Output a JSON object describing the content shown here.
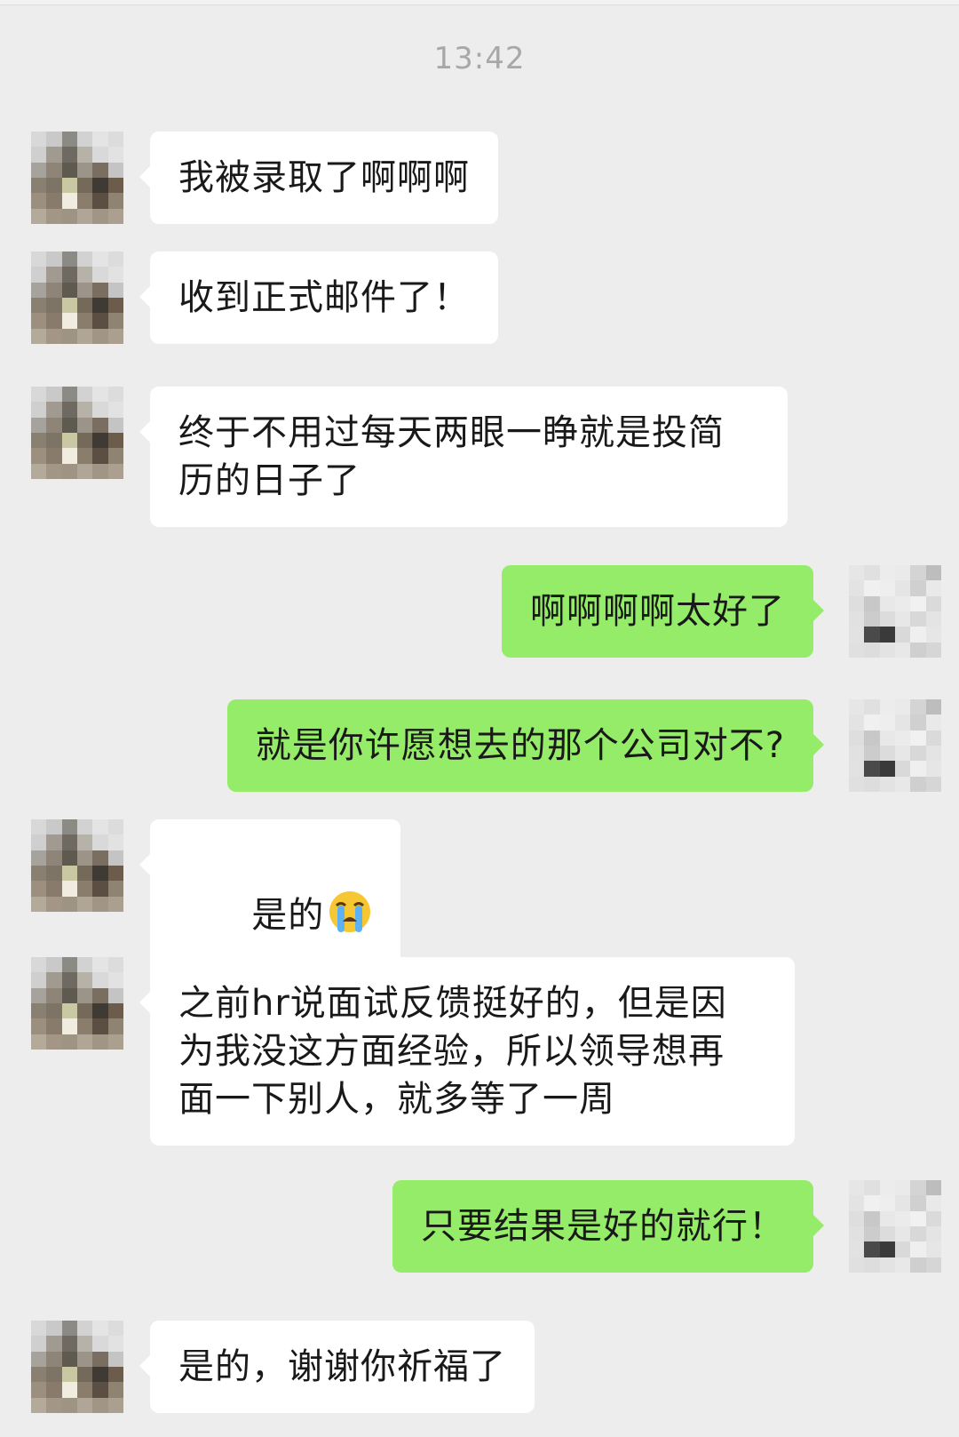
{
  "timestamp": "13:42",
  "messages": [
    {
      "side": "left",
      "text": "我被录取了啊啊啊"
    },
    {
      "side": "left",
      "text": "收到正式邮件了！"
    },
    {
      "side": "left",
      "text": "终于不用过每天两眼一睁就是投简\n历的日子了"
    },
    {
      "side": "right",
      "text": "啊啊啊啊太好了"
    },
    {
      "side": "right",
      "text": "就是你许愿想去的那个公司对不?"
    },
    {
      "side": "left",
      "text": "是的",
      "emoji": "crying-face-emoji"
    },
    {
      "side": "left",
      "text": "之前hr说面试反馈挺好的，但是因\n为我没这方面经验，所以领导想再\n面一下别人，就多等了一周"
    },
    {
      "side": "right",
      "text": "只要结果是好的就行！"
    },
    {
      "side": "left",
      "text": "是的，谢谢你祈福了"
    }
  ],
  "colors": {
    "background": "#ededed",
    "bubble_incoming": "#ffffff",
    "bubble_outgoing": "#95ec69",
    "timestamp": "#a8a8a8"
  },
  "avatars": {
    "contact": "pixelated-avatar",
    "self": "pixelated-avatar"
  }
}
